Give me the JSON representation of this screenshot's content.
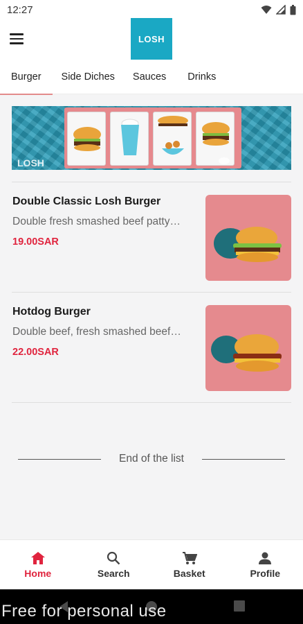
{
  "status_bar": {
    "time": "12:27"
  },
  "app_bar": {
    "logo_text": "LOSH"
  },
  "tabs": [
    {
      "label": "Burger",
      "active": true
    },
    {
      "label": "Side Diches",
      "active": false
    },
    {
      "label": "Sauces",
      "active": false
    },
    {
      "label": "Drinks",
      "active": false
    }
  ],
  "banner": {
    "logo_text": "LOSH"
  },
  "menu_items": [
    {
      "name": "Double Classic Losh Burger",
      "description": "Double fresh smashed beef patty…",
      "price": "19.00SAR"
    },
    {
      "name": "Hotdog Burger",
      "description": "Double beef, fresh smashed beef…",
      "price": "22.00SAR"
    }
  ],
  "end_of_list": "End of the list",
  "bottom_nav": [
    {
      "label": "Home",
      "icon": "home-icon",
      "active": true
    },
    {
      "label": "Search",
      "icon": "search-icon",
      "active": false
    },
    {
      "label": "Basket",
      "icon": "cart-icon",
      "active": false
    },
    {
      "label": "Profile",
      "icon": "person-icon",
      "active": false
    }
  ],
  "watermark": "Free for personal use",
  "colors": {
    "accent": "#e0243e",
    "brand": "#1aa8c4",
    "tab_indicator": "#e38a8a"
  }
}
